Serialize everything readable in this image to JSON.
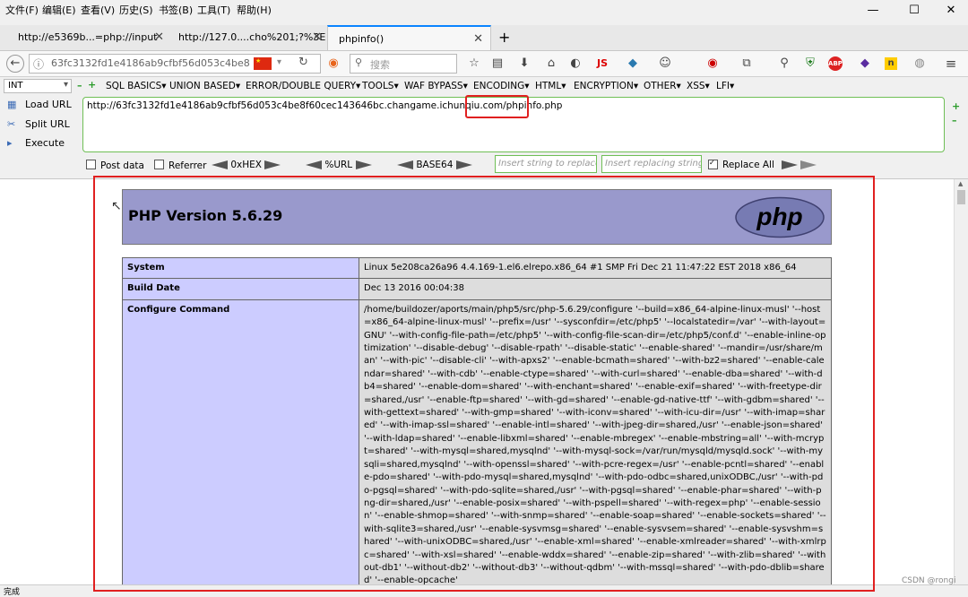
{
  "menubar": {
    "items": [
      "文件(F)",
      "编辑(E)",
      "查看(V)",
      "历史(S)",
      "书签(B)",
      "工具(T)",
      "帮助(H)"
    ]
  },
  "window_controls": {
    "minimize": "—",
    "maximize": "☐",
    "close": "✕"
  },
  "tabs": [
    {
      "label": "http://e5369b...=php://input",
      "active": false
    },
    {
      "label": "http://127.0....cho%201;?%3E",
      "active": false
    },
    {
      "label": "phpinfo()",
      "active": true
    }
  ],
  "new_tab_label": "+",
  "navbar": {
    "url": "63fc3132fd1e4186ab9cfbf56d053c4be8",
    "search_placeholder": "搜索",
    "js_label": "JS"
  },
  "hackbar": {
    "type_select": "INT",
    "menu": [
      "SQL BASICS▾",
      "UNION BASED▾",
      "ERROR/DOUBLE QUERY▾",
      "TOOLS▾",
      "WAF BYPASS▾",
      "ENCODING▾",
      "HTML▾",
      "ENCRYPTION▾",
      "OTHER▾",
      "XSS▾",
      "LFI▾"
    ],
    "load_url": "Load URL",
    "split_url": "Split URL",
    "execute": "Execute",
    "url_value_prefix": "http://63fc3132fd1e4186ab9cfbf56d053c4be8f60cec143646bc.changame.ichunqiu.com/",
    "url_value_highlight": "phpinfo.php",
    "post_data": "Post data",
    "referrer": "Referrer",
    "hex": "0xHEX",
    "url_enc": "%URL",
    "base64": "BASE64",
    "insert_string_placeholder": "Insert string to replace",
    "insert_replacing_placeholder": "Insert replacing string",
    "replace_all": "Replace All"
  },
  "phpinfo": {
    "version_title": "PHP Version 5.6.29",
    "logo_text": "php",
    "rows": [
      {
        "key": "System",
        "value": "Linux 5e208ca26a96 4.4.169-1.el6.elrepo.x86_64 #1 SMP Fri Dec 21 11:47:22 EST 2018 x86_64"
      },
      {
        "key": "Build Date",
        "value": "Dec 13 2016 00:04:38"
      },
      {
        "key": "Configure Command",
        "value": "/home/buildozer/aports/main/php5/src/php-5.6.29/configure '--build=x86_64-alpine-linux-musl' '--host=x86_64-alpine-linux-musl' '--prefix=/usr' '--sysconfdir=/etc/php5' '--localstatedir=/var' '--with-layout=GNU' '--with-config-file-path=/etc/php5' '--with-config-file-scan-dir=/etc/php5/conf.d' '--enable-inline-optimization' '--disable-debug' '--disable-rpath' '--disable-static' '--enable-shared' '--mandir=/usr/share/man' '--with-pic' '--disable-cli' '--with-apxs2' '--enable-bcmath=shared' '--with-bz2=shared' '--enable-calendar=shared' '--with-cdb' '--enable-ctype=shared' '--with-curl=shared' '--enable-dba=shared' '--with-db4=shared' '--enable-dom=shared' '--with-enchant=shared' '--enable-exif=shared' '--with-freetype-dir=shared,/usr' '--enable-ftp=shared' '--with-gd=shared' '--enable-gd-native-ttf' '--with-gdbm=shared' '--with-gettext=shared' '--with-gmp=shared' '--with-iconv=shared' '--with-icu-dir=/usr' '--with-imap=shared' '--with-imap-ssl=shared' '--enable-intl=shared' '--with-jpeg-dir=shared,/usr' '--enable-json=shared' '--with-ldap=shared' '--enable-libxml=shared' '--enable-mbregex' '--enable-mbstring=all' '--with-mcrypt=shared' '--with-mysql=shared,mysqlnd' '--with-mysql-sock=/var/run/mysqld/mysqld.sock' '--with-mysqli=shared,mysqlnd' '--with-openssl=shared' '--with-pcre-regex=/usr' '--enable-pcntl=shared' '--enable-pdo=shared' '--with-pdo-mysql=shared,mysqlnd' '--with-pdo-odbc=shared,unixODBC,/usr' '--with-pdo-pgsql=shared' '--with-pdo-sqlite=shared,/usr' '--with-pgsql=shared' '--enable-phar=shared' '--with-png-dir=shared,/usr' '--enable-posix=shared' '--with-pspell=shared' '--with-regex=php' '--enable-session' '--enable-shmop=shared' '--with-snmp=shared' '--enable-soap=shared' '--enable-sockets=shared' '--with-sqlite3=shared,/usr' '--enable-sysvmsg=shared' '--enable-sysvsem=shared' '--enable-sysvshm=shared' '--with-unixODBC=shared,/usr' '--enable-xml=shared' '--enable-xmlreader=shared' '--with-xmlrpc=shared' '--with-xsl=shared' '--enable-wddx=shared' '--enable-zip=shared' '--with-zlib=shared' '--without-db1' '--without-db2' '--without-db3' '--without-qdbm' '--with-mssql=shared' '--with-pdo-dblib=shared' '--enable-opcache'"
      }
    ]
  },
  "status": {
    "left": "完成",
    "watermark": "CSDN @rongi"
  },
  "colors": {
    "annotation": "#e02020",
    "php_header": "#9999cc",
    "key_cell": "#ccccff",
    "value_cell": "#dddddd",
    "hackbar_border": "#6fbf56"
  }
}
